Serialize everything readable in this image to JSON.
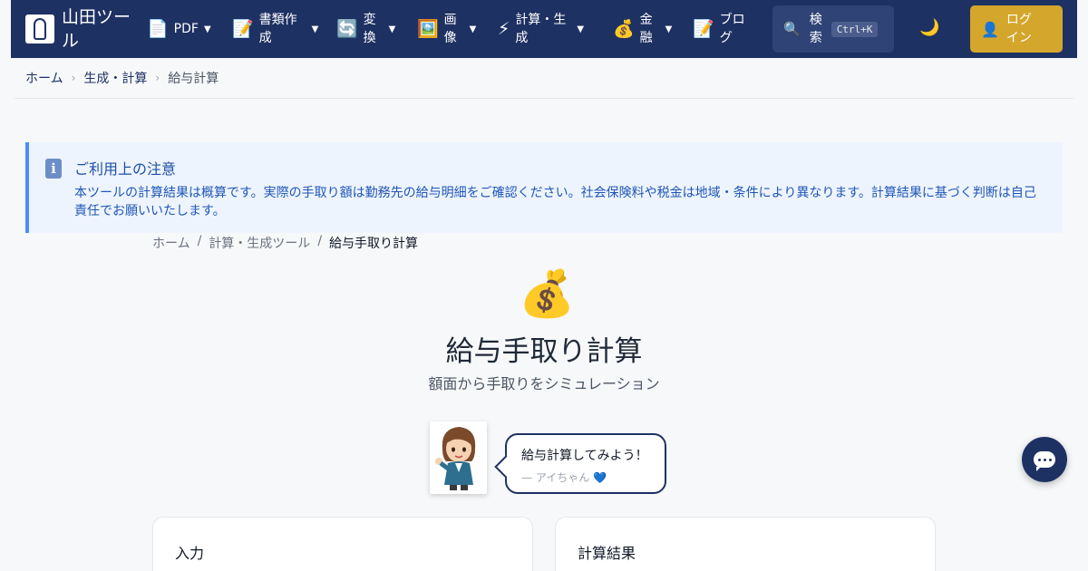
{
  "navbar": {
    "brand": "山田ツール",
    "items": [
      {
        "icon": "📄",
        "label": "PDF",
        "icon_name": "document-icon"
      },
      {
        "icon": "📝",
        "label": "書類作成",
        "icon_name": "memo-icon"
      },
      {
        "icon": "🔄",
        "label": "変換",
        "icon_name": "convert-icon"
      },
      {
        "icon": "🖼️",
        "label": "画像",
        "icon_name": "image-icon"
      },
      {
        "icon": "⚡",
        "label": "計算・生成",
        "icon_name": "lightning-icon"
      },
      {
        "icon": "💰",
        "label": "金融",
        "icon_name": "money-bag-icon"
      },
      {
        "icon": "📝",
        "label": "ブログ",
        "icon_name": "memo-icon"
      }
    ],
    "caret": "▼",
    "search": {
      "icon": "🔍",
      "label": "検索",
      "shortcut": "Ctrl+K"
    },
    "theme_icon": "🌙",
    "login": {
      "icon": "👤",
      "label": "ログイン"
    },
    "colors": {
      "bg": "#1e3163",
      "login": "#d5a62c"
    }
  },
  "breadcrumb_top": {
    "home": "ホーム",
    "section": "生成・計算",
    "current": "給与計算",
    "sep": "›"
  },
  "notice": {
    "icon": "i",
    "title": "ご利用上の注意",
    "text": "本ツールの計算結果は概算です。実際の手取り額は勤務先の給与明細をご確認ください。社会保険料や税金は地域・条件により異なります。計算結果に基づく判断は自己責任でお願いいたします。"
  },
  "breadcrumb_page": {
    "home": "ホーム",
    "section": "計算・生成ツール",
    "current": "給与手取り計算",
    "sep": "/"
  },
  "hero": {
    "icon": "💰",
    "title": "給与手取り計算",
    "subtitle": "額面から手取りをシミュレーション"
  },
  "mascot": {
    "message": "給与計算してみよう！",
    "signature": "— アイちゃん 💙"
  },
  "cards": {
    "input_title": "入力",
    "result_title": "計算結果"
  }
}
